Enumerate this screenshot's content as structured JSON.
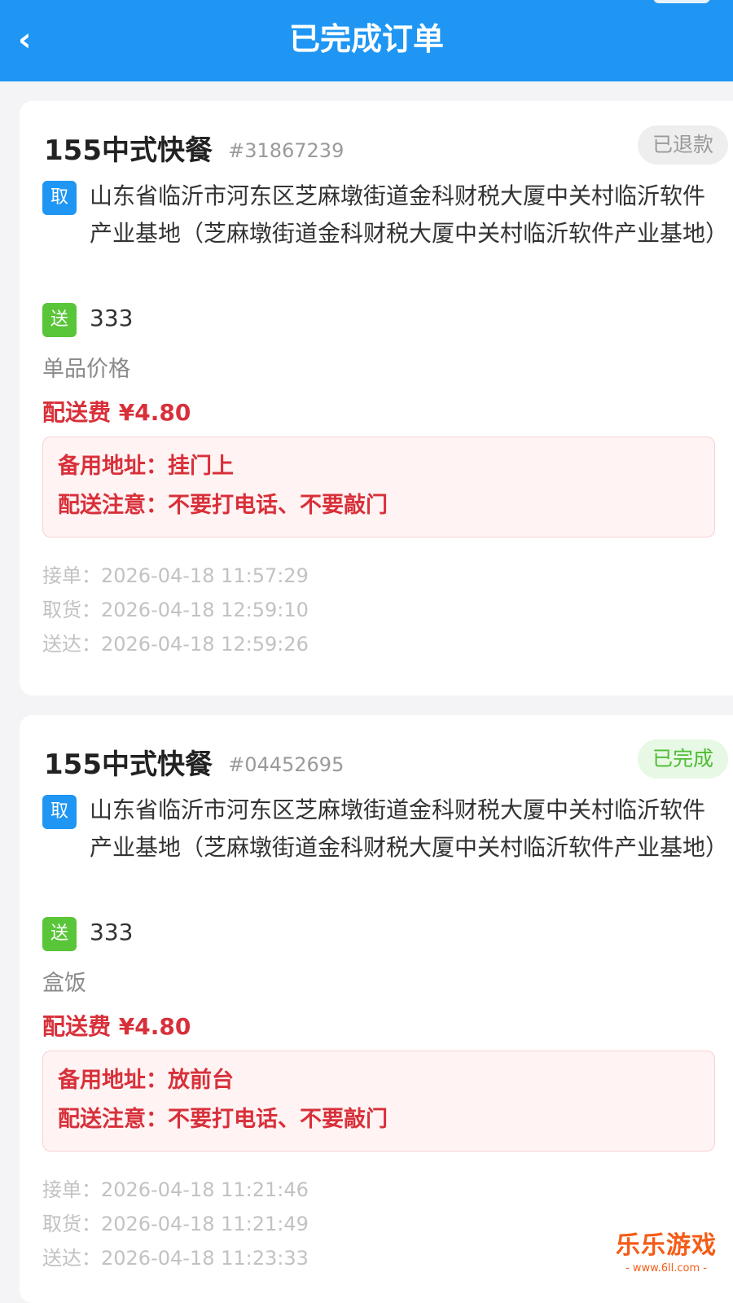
{
  "header": {
    "title": "已完成订单",
    "back_icon": "‹"
  },
  "orders": [
    {
      "shop": "155中式快餐",
      "order_no": "#31867239",
      "status": "已退款",
      "pickup_tag": "取",
      "pickup_address": "山东省临沂市河东区芝麻墩街道金科财税大厦中关村临沂软件产业基地（芝麻墩街道金科财税大厦中关村临沂软件产业基地）",
      "delivery_tag": "送",
      "delivery_address": "333",
      "item": "单品价格",
      "fee": "配送费 ¥4.80",
      "alt_address_label": "备用地址：",
      "alt_address": "挂门上",
      "delivery_note_label": "配送注意：",
      "delivery_note": "不要打电话、不要敲门",
      "accepted_label": "接单：",
      "accepted": "2026-04-18 11:57:29",
      "picked_label": "取货：",
      "picked": "2026-04-18 12:59:10",
      "delivered_label": "送达：",
      "delivered": "2026-04-18 12:59:26"
    },
    {
      "shop": "155中式快餐",
      "order_no": "#04452695",
      "status": "已完成",
      "pickup_tag": "取",
      "pickup_address": "山东省临沂市河东区芝麻墩街道金科财税大厦中关村临沂软件产业基地（芝麻墩街道金科财税大厦中关村临沂软件产业基地）",
      "delivery_tag": "送",
      "delivery_address": "333",
      "item": "盒饭",
      "fee": "配送费 ¥4.80",
      "alt_address_label": "备用地址：",
      "alt_address": "放前台",
      "delivery_note_label": "配送注意：",
      "delivery_note": "不要打电话、不要敲门",
      "accepted_label": "接单：",
      "accepted": "2026-04-18 11:21:46",
      "picked_label": "取货：",
      "picked": "2026-04-18 11:21:49",
      "delivered_label": "送达：",
      "delivered": "2026-04-18 11:23:33"
    }
  ],
  "watermark": {
    "text": "乐乐游戏",
    "url": "- www.6ll.com -"
  }
}
